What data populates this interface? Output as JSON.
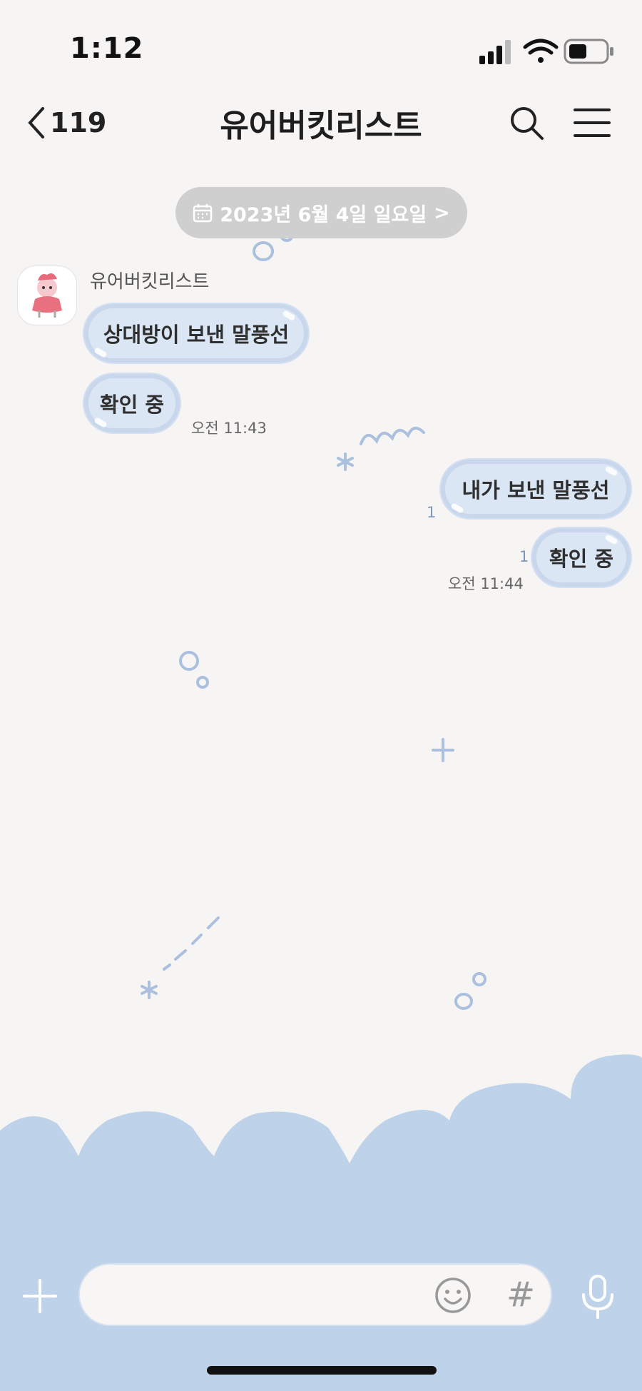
{
  "status_bar": {
    "time": "1:12"
  },
  "header": {
    "back_count": "119",
    "title": "유어버킷리스트"
  },
  "date_divider": {
    "label": "2023년 6월 4일 일요일",
    "chevron": ">"
  },
  "messages": [
    {
      "sender": "유어버킷리스트",
      "bubbles": [
        "상대방이 보낸 말풍선",
        "확인 중"
      ],
      "time": "오전 11:43"
    },
    {
      "sender": "me",
      "bubbles": [
        "내가 보낸 말풍선",
        "확인 중"
      ],
      "read_counts": [
        "1",
        "1"
      ],
      "time": "오전 11:44"
    }
  ],
  "input_bar": {
    "placeholder": "",
    "hash_label": "#"
  },
  "colors": {
    "background": "#f7f5f3",
    "bubble_fill": "#dbe6f4",
    "bubble_border": "#c8d7ec",
    "bottom_wave": "#bed2e9",
    "date_pill": "#cfcfcf",
    "read_count": "#7d96bb"
  },
  "icons": [
    "signal-icon",
    "wifi-icon",
    "battery-icon",
    "back-chevron-icon",
    "search-icon",
    "menu-icon",
    "calendar-icon",
    "plus-icon",
    "emoji-icon",
    "hash-icon",
    "mic-icon"
  ]
}
